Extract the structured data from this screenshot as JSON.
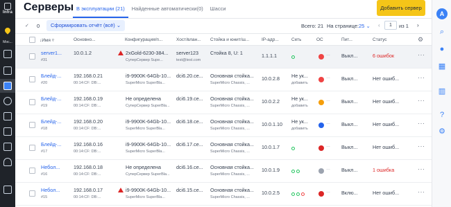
{
  "rail": {
    "brand": "Infra",
    "location": "Мос..."
  },
  "header": {
    "title": "Серверы",
    "tabs": [
      {
        "label": "В эксплуатации (21)",
        "active": true
      },
      {
        "label": "Найденные автоматически(0)",
        "active": false
      },
      {
        "label": "Шасси",
        "active": false
      }
    ],
    "add_button": "Добавить сервер"
  },
  "toolbar": {
    "selected_count": "0",
    "report_button": "Сформировать отчёт (всё)",
    "total": "Всего: 21",
    "per_page_label": "На странице:",
    "per_page": "25",
    "page": "1",
    "of_pages": "из 1"
  },
  "columns": [
    "Имя",
    "Основно...",
    "Конфигурация/п...",
    "Хост/влан...",
    "Стойка и юнит/ш...",
    "IP-адр...",
    "Сеть",
    "ОС",
    "Пит...",
    "Статус"
  ],
  "rows": [
    {
      "name": "server1...",
      "id": "#31",
      "ip": "10.0.1.2",
      "ip_sub": "",
      "config": "2xGold-6230-384...",
      "config_sub": "СуперСервер Supe...",
      "config_warn": true,
      "host": "server123",
      "host_sub": "test@test.com",
      "rack": "Стойка 8, U: 1",
      "rack_sub": "",
      "ipaddr": "1.1.1.1",
      "net": "",
      "net_sub": "",
      "os_color": "#ef4444",
      "power": "Выкл...",
      "status": "6 ошибок",
      "status_err": true,
      "selected": true
    },
    {
      "name": "Блейд-...",
      "id": "#20",
      "ip": "192.168.0.21",
      "ip_sub": "00:14:CF: DB:...",
      "config": "i9-9900K-64Gb-10...",
      "config_sub": "SuperMicro SuperBla...",
      "config_warn": false,
      "host": "dci6.20.ce...",
      "host_sub": "",
      "rack": "Основная стойка...",
      "rack_sub": "SuperMicro Chassis, ...",
      "ipaddr": "10.0.2.8",
      "net": "Не ук...",
      "net_sub": "добавить",
      "os_color": "#ef4444",
      "power": "Выкл...",
      "status": "Нет ошиб...",
      "status_err": false,
      "selected": false
    },
    {
      "name": "Блейд-...",
      "id": "#19",
      "ip": "192.168.0.19",
      "ip_sub": "00:14:CF: DB:...",
      "config": "Не определена",
      "config_sub": "СуперСервер SuperBla...",
      "config_warn": false,
      "host": "dci6.19.ce...",
      "host_sub": "",
      "rack": "Основная стойка...",
      "rack_sub": "SuperMicro Chassis, ...",
      "ipaddr": "10.0.2.2",
      "net": "Не ук...",
      "net_sub": "добавить",
      "os_color": "#f59e0b",
      "power": "Выкл...",
      "status": "Нет ошиб...",
      "status_err": false,
      "selected": false
    },
    {
      "name": "Блейд-...",
      "id": "#18",
      "ip": "192.168.0.20",
      "ip_sub": "00:14:CF: DB:...",
      "config": "i9-9900K-64Gb-10...",
      "config_sub": "SuperMicro SuperBla...",
      "config_warn": false,
      "host": "dci6.18.ce...",
      "host_sub": "",
      "rack": "Основная стойка...",
      "rack_sub": "SuperMicro Chassis, ...",
      "ipaddr": "10.0.1.10",
      "net": "Не ук...",
      "net_sub": "добавить",
      "os_color": "#2563eb",
      "power": "Выкл...",
      "status": "Нет ошиб...",
      "status_err": false,
      "selected": false
    },
    {
      "name": "Блейд-...",
      "id": "#17",
      "ip": "192.168.0.16",
      "ip_sub": "00:14:CF: DB:...",
      "config": "i9-9900K-64Gb-10...",
      "config_sub": "SuperMicro SuperBla...",
      "config_warn": false,
      "host": "dci6.17.ce...",
      "host_sub": "",
      "rack": "Основная стойка...",
      "rack_sub": "SuperMicro Chassis, ...",
      "ipaddr": "10.0.1.7",
      "net": "",
      "net_sub": "",
      "os_color": "#dc2626",
      "power": "Выкл...",
      "status": "Нет ошиб...",
      "status_err": false,
      "selected": false
    },
    {
      "name": "Небол...",
      "id": "#16",
      "ip": "192.168.0.18",
      "ip_sub": "00:14:CF: DB:...",
      "config": "Не определена",
      "config_sub": "СуперСервер SuperBla...",
      "config_warn": false,
      "host": "dci6.16.ce...",
      "host_sub": "",
      "rack": "Основная стойка...",
      "rack_sub": "SuperMicro Chassis, ...",
      "ipaddr": "10.0.1.9",
      "net": "",
      "net_sub": "",
      "os_color": "#9ca3af",
      "power": "Выкл...",
      "status": "1 ошибка",
      "status_err": true,
      "selected": false
    },
    {
      "name": "Небол...",
      "id": "#15",
      "ip": "192.168.0.17",
      "ip_sub": "00:14:CF: DB:...",
      "config": "i9-9900K-64Gb-10...",
      "config_sub": "SuperMicro SuperBla...",
      "config_warn": true,
      "host": "dci6.15.ce...",
      "host_sub": "",
      "rack": "Основная стойка...",
      "rack_sub": "SuperMicro Chassis, ...",
      "ipaddr": "10.0.2.5",
      "net": "",
      "net_sub": "",
      "os_color": "#dc2626",
      "power": "Вклю...",
      "status": "Нет ошиб...",
      "status_err": false,
      "selected": false
    }
  ],
  "colors": {
    "accent": "#2563eb",
    "brand_yellow": "#f5c518",
    "error": "#dc2626",
    "rail_dark": "#1f2329"
  }
}
